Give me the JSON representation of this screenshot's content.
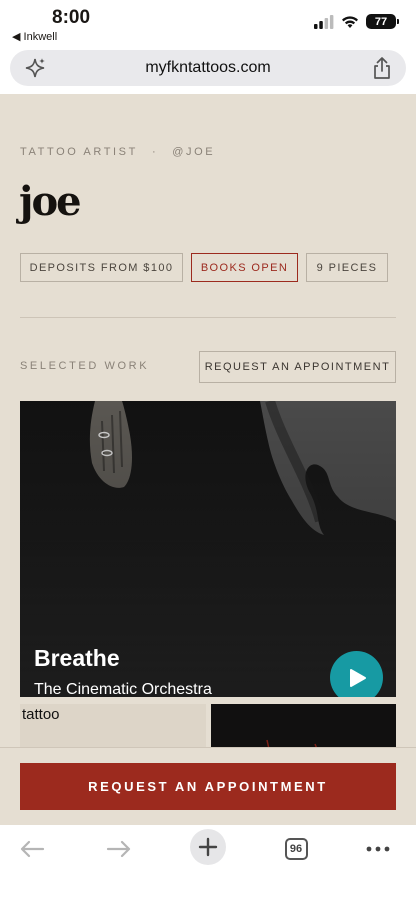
{
  "status": {
    "time": "8:00",
    "back_app": "◀ Inkwell",
    "battery": "77"
  },
  "browser": {
    "url": "myfkntattoos.com",
    "tab_count": "96"
  },
  "profile": {
    "role": "TATTOO ARTIST",
    "separator": "·",
    "handle": "@JOE",
    "name": "joe",
    "tags": [
      "DEPOSITS FROM $100",
      "BOOKS OPEN",
      "9 PIECES"
    ]
  },
  "work": {
    "section_label": "SELECTED WORK",
    "request_button": "REQUEST AN APPOINTMENT",
    "player": {
      "title": "Breathe",
      "artist": "The Cinematic Orchestra"
    },
    "thumb_label": "tattoo"
  },
  "cta": {
    "label": "REQUEST AN APPOINTMENT"
  },
  "colors": {
    "accent": "#9c2a1e",
    "background": "#e5ded2",
    "play": "#179aa3"
  },
  "icons": [
    "sparkle-icon",
    "share-icon",
    "back-arrow-icon",
    "forward-arrow-icon",
    "new-tab-icon",
    "more-icon",
    "play-icon"
  ]
}
